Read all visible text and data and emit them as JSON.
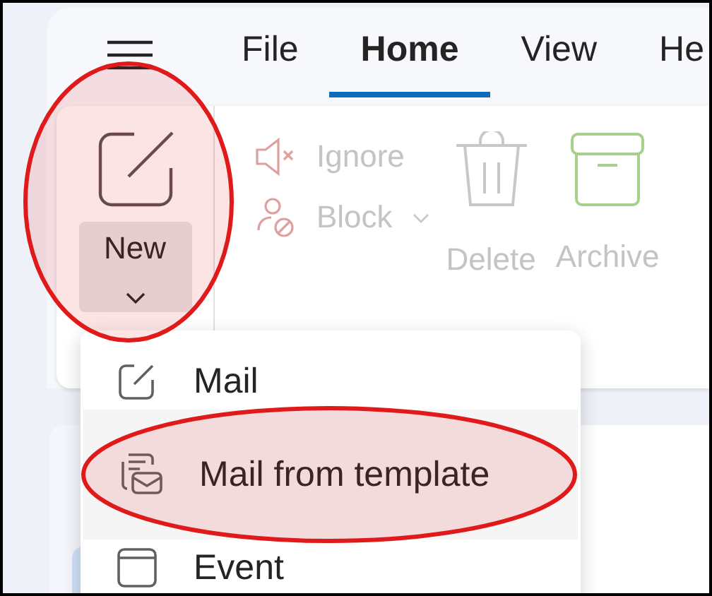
{
  "tabs": [
    {
      "label": "File",
      "selected": false
    },
    {
      "label": "Home",
      "selected": true
    },
    {
      "label": "View",
      "selected": false
    },
    {
      "label": "He",
      "selected": false
    }
  ],
  "ribbon": {
    "new_button": {
      "label": "New"
    },
    "commands": [
      {
        "kind": "small",
        "label": "Ignore",
        "disabled": true
      },
      {
        "kind": "split",
        "label": "Block",
        "disabled": true
      },
      {
        "kind": "large",
        "label": "Delete",
        "disabled": true
      },
      {
        "kind": "large",
        "label": "Archive",
        "disabled": true
      }
    ]
  },
  "new_menu": {
    "items": [
      {
        "label": "Mail",
        "selected": false
      },
      {
        "label": "Mail from template",
        "selected": true
      },
      {
        "label": "Event",
        "selected": false
      }
    ]
  }
}
